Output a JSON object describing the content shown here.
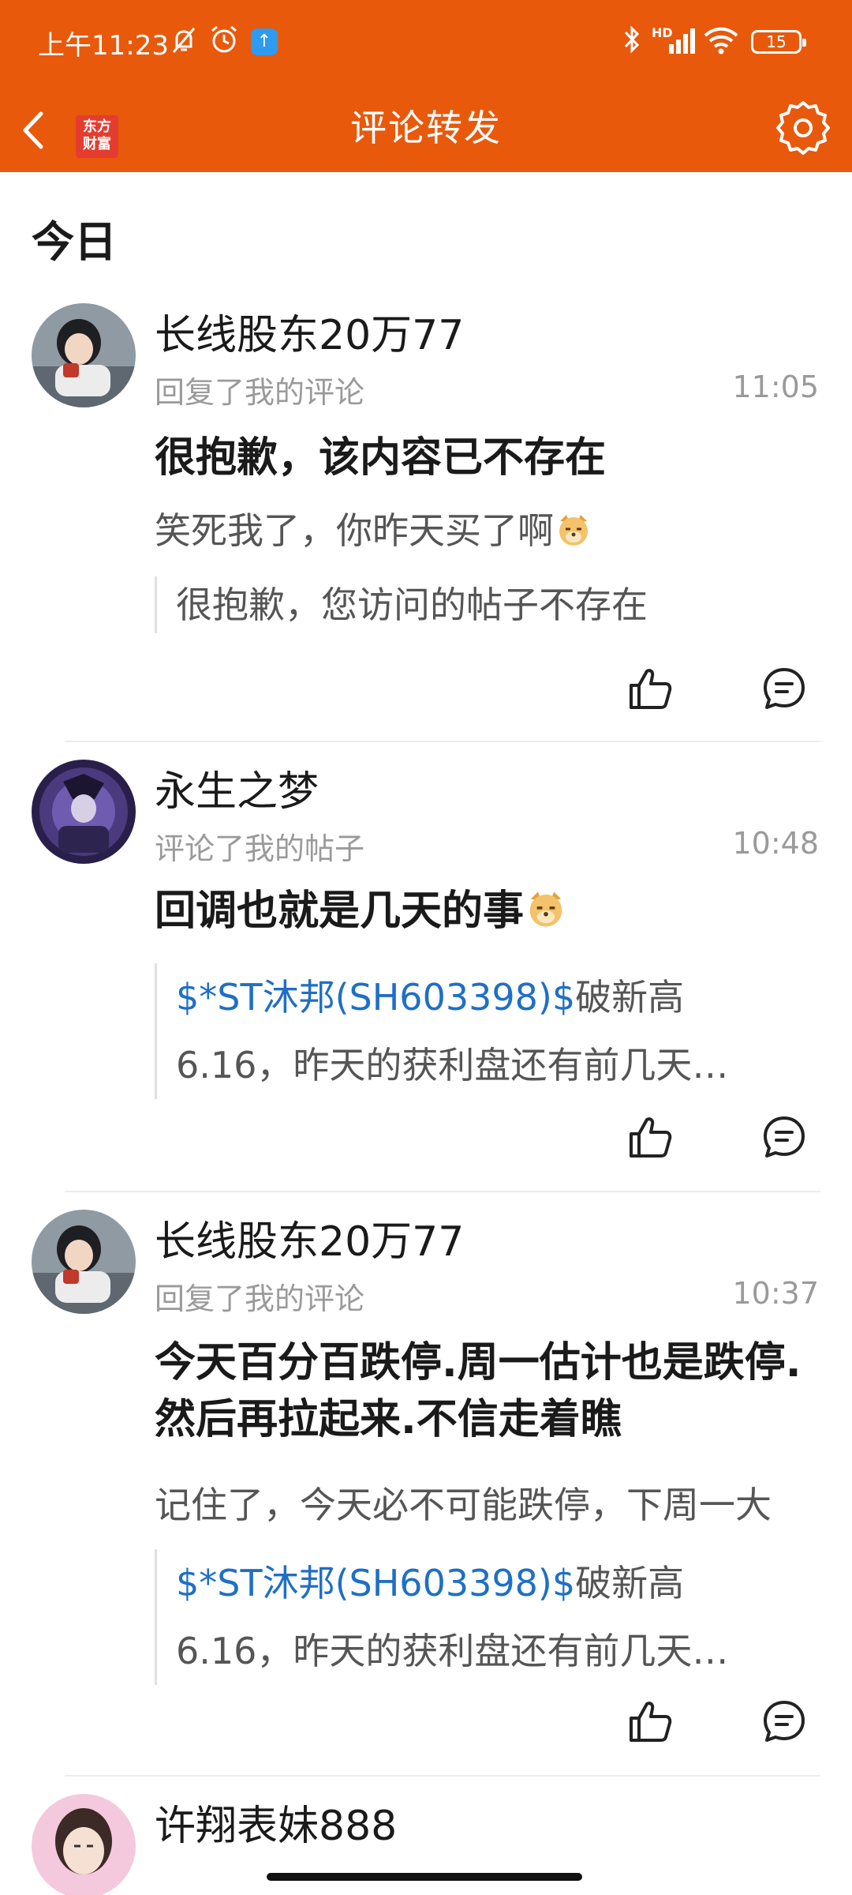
{
  "status_bar": {
    "time": "上午11:23",
    "battery": "15",
    "network_label": "HD"
  },
  "header": {
    "title": "评论转发",
    "app_logo_line1": "东方",
    "app_logo_line2": "财富",
    "accent_color": "#e8590c"
  },
  "section": {
    "title": "今日"
  },
  "notifications": [
    {
      "username": "长线股东20万77",
      "action": "回复了我的评论",
      "time": "11:05",
      "reply_text": " 很抱歉，该内容已不存在",
      "my_comment": "笑死我了，你昨天买了啊",
      "quote_line1": "很抱歉，您访问的帖子不存在"
    },
    {
      "username": "永生之梦",
      "action": "评论了我的帖子",
      "time": "10:48",
      "reply_text": "回调也就是几天的事",
      "quote_stock": "$*ST沐邦(SH603398)$",
      "quote_line1_rest": "破新高",
      "quote_line2": "6.16，昨天的获利盘还有前几天…"
    },
    {
      "username": "长线股东20万77",
      "action": "回复了我的评论",
      "time": "10:37",
      "reply_text": "今天百分百跌停.周一估计也是跌停.然后再拉起来.不信走着瞧",
      "my_comment": "记住了，今天必不可能跌停，下周一大",
      "quote_stock": "$*ST沐邦(SH603398)$",
      "quote_line1_rest": "破新高",
      "quote_line2": "6.16，昨天的获利盘还有前几天…"
    },
    {
      "username": "许翔表妹888"
    }
  ]
}
